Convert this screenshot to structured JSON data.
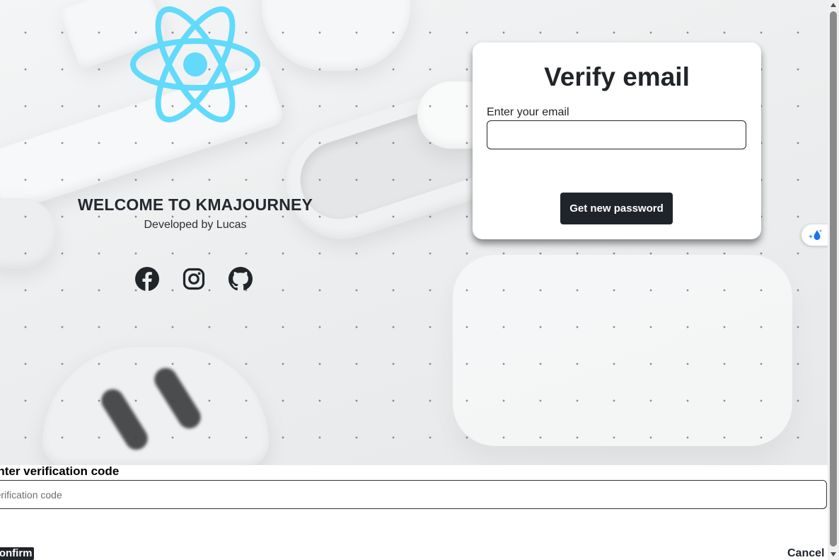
{
  "hero": {
    "logo_icon": "react-logo",
    "logo_color": "#61dafb",
    "welcome_title": "WELCOME TO KMAJOURNEY",
    "developer_text": "Developed by Lucas",
    "socials": [
      "facebook-icon",
      "instagram-icon",
      "github-icon"
    ]
  },
  "verify_card": {
    "title": "Verify email",
    "email_label": "Enter your email",
    "email_value": "",
    "submit_label": "Get new password"
  },
  "side_widget": {
    "icon": "sparkle-drop-icon",
    "color": "#1a73e8"
  },
  "verification": {
    "label": "Enter verification code",
    "placeholder": "Verification code",
    "value": "",
    "confirm_label": "Confirm",
    "cancel_label": "Cancel"
  },
  "colors": {
    "primary_button": "#1f242b",
    "text": "#212529"
  }
}
